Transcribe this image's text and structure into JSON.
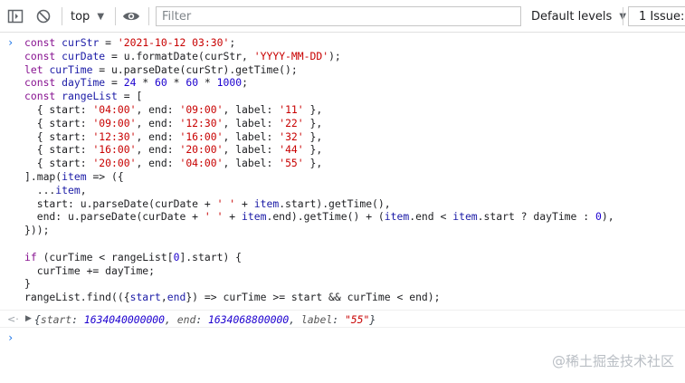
{
  "toolbar": {
    "context": "top",
    "filter_placeholder": "Filter",
    "levels": "Default levels",
    "issues": "1 Issue: "
  },
  "code_lines": [
    "const curStr = '2021-10-12 03:30';",
    "const curDate = u.formatDate(curStr, 'YYYY-MM-DD');",
    "let curTime = u.parseDate(curStr).getTime();",
    "const dayTime = 24 * 60 * 60 * 1000;",
    "const rangeList = [",
    "  { start: '04:00', end: '09:00', label: '11' },",
    "  { start: '09:00', end: '12:30', label: '22' },",
    "  { start: '12:30', end: '16:00', label: '32' },",
    "  { start: '16:00', end: '20:00', label: '44' },",
    "  { start: '20:00', end: '04:00', label: '55' },",
    "].map(item => ({",
    "  ...item,",
    "  start: u.parseDate(curDate + ' ' + item.start).getTime(),",
    "  end: u.parseDate(curDate + ' ' + item.end).getTime() + (item.end < item.start ? dayTime : 0),",
    "}));",
    "",
    "if (curTime < rangeList[0].start) {",
    "  curTime += dayTime;",
    "}",
    "rangeList.find(({start,end}) => curTime >= start && curTime < end);"
  ],
  "result": {
    "start_key": "start",
    "start_value": "1634040000000",
    "end_key": "end",
    "end_value": "1634068800000",
    "label_key": "label",
    "label_value": "\"55\""
  },
  "watermark": "@稀土掘金技术社区"
}
